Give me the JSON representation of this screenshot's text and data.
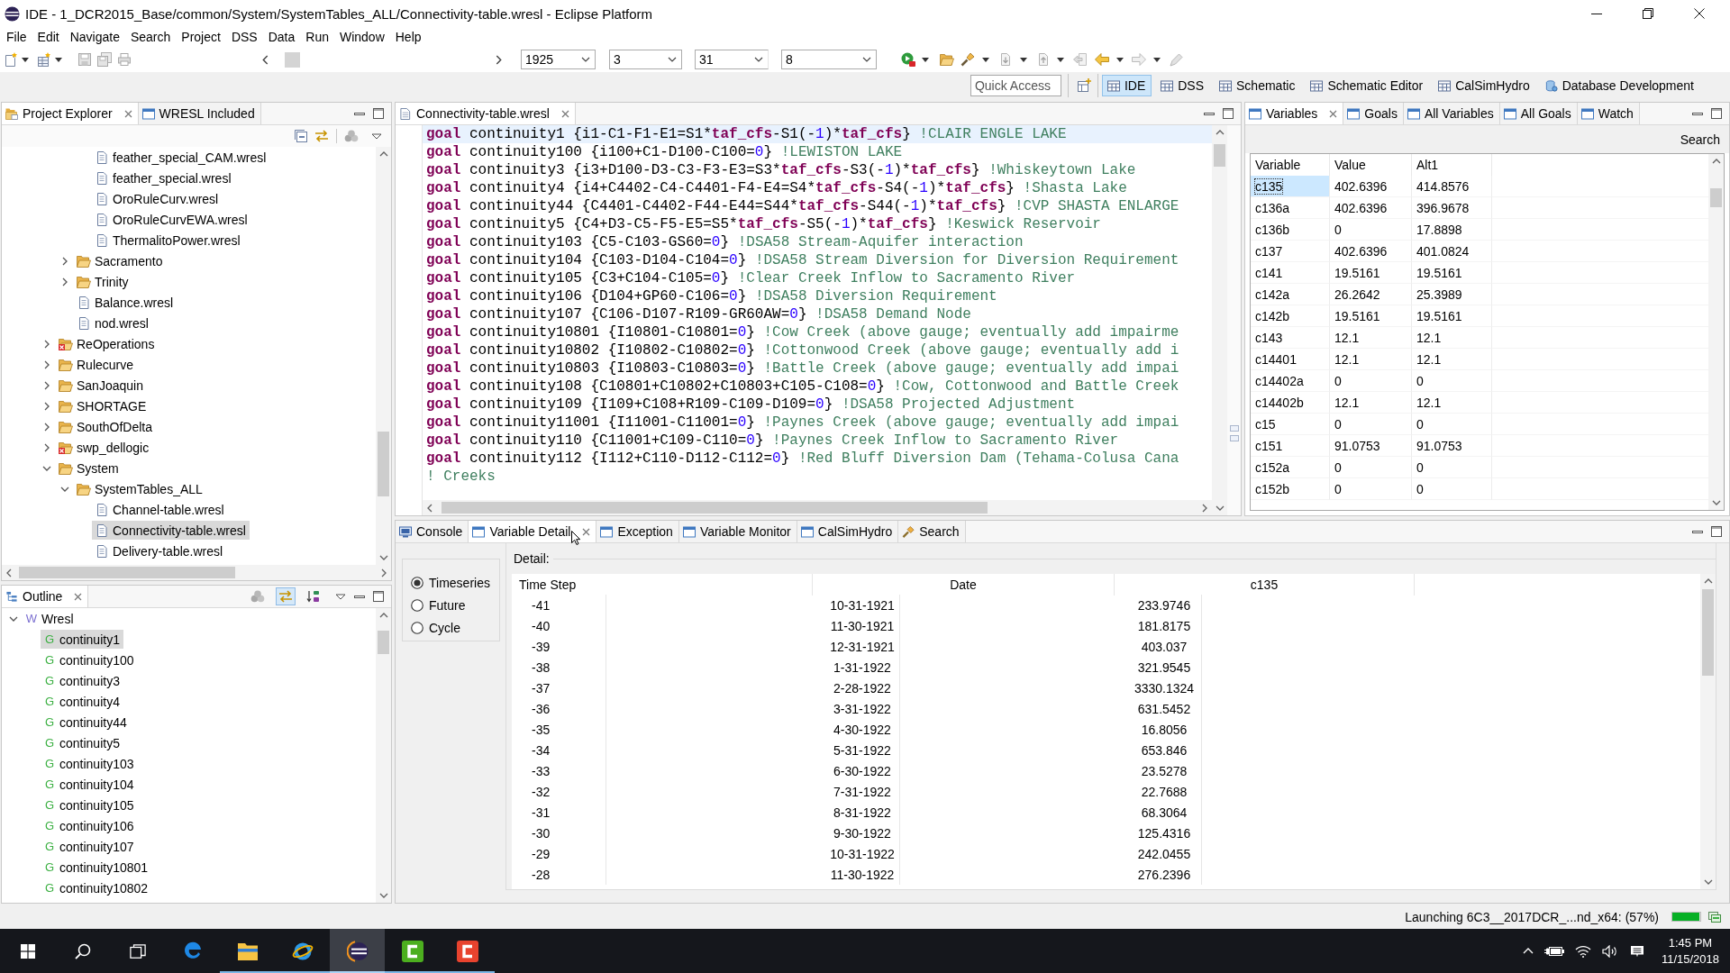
{
  "window": {
    "title": "IDE - 1_DCR2015_Base/common/System/SystemTables_ALL/Connectivity-table.wresl - Eclipse Platform"
  },
  "menu": [
    "File",
    "Edit",
    "Navigate",
    "Search",
    "Project",
    "DSS",
    "Data",
    "Run",
    "Window",
    "Help"
  ],
  "toolbar": {
    "dropdowns": [
      "1925",
      "3",
      "31",
      "8"
    ]
  },
  "perspective_bar": {
    "quick_access": {
      "placeholder": "Quick Access"
    },
    "perspectives": [
      {
        "label": "IDE",
        "kind": "grid",
        "selected": true
      },
      {
        "label": "DSS",
        "kind": "grid",
        "selected": false
      },
      {
        "label": "Schematic",
        "kind": "grid",
        "selected": false
      },
      {
        "label": "Schematic Editor",
        "kind": "grid",
        "selected": false
      },
      {
        "label": "CalSimHydro",
        "kind": "grid",
        "selected": false
      },
      {
        "label": "Database Development",
        "kind": "database",
        "selected": false
      }
    ]
  },
  "project_explorer": {
    "tabs": [
      {
        "label": "Project Explorer",
        "kind": "explorer",
        "selected": true
      },
      {
        "label": "WRESL Included",
        "kind": "view",
        "selected": false
      }
    ],
    "tree": [
      {
        "children": [
          {
            "children": [
              {
                "kind": "file",
                "label": "feather_special_CAM.wresl",
                "selected": false,
                "error": false
              },
              {
                "kind": "file",
                "label": "feather_special.wresl",
                "selected": false,
                "error": false
              },
              {
                "kind": "file",
                "label": "OroRuleCurv.wresl",
                "selected": false,
                "error": false
              },
              {
                "kind": "file",
                "label": "OroRuleCurvEWA.wresl",
                "selected": false,
                "error": false
              },
              {
                "kind": "file",
                "label": "ThermalitoPower.wresl",
                "selected": false,
                "error": false
              }
            ]
          },
          {
            "kind": "folder",
            "label": "Sacramento",
            "expanded": false,
            "selected": false,
            "error": false
          },
          {
            "kind": "folder",
            "label": "Trinity",
            "expanded": false,
            "selected": false,
            "error": false
          },
          {
            "kind": "file",
            "label": "Balance.wresl",
            "selected": false,
            "error": false
          },
          {
            "kind": "file",
            "label": "nod.wresl",
            "selected": false,
            "error": false
          }
        ]
      },
      {
        "kind": "folder",
        "label": "ReOperations",
        "expanded": false,
        "selected": false,
        "error": true
      },
      {
        "kind": "folder",
        "label": "Rulecurve",
        "expanded": false,
        "selected": false,
        "error": false
      },
      {
        "kind": "folder",
        "label": "SanJoaquin",
        "expanded": false,
        "selected": false,
        "error": false
      },
      {
        "kind": "folder",
        "label": "SHORTAGE",
        "expanded": false,
        "selected": false,
        "error": false
      },
      {
        "kind": "folder",
        "label": "SouthOfDelta",
        "expanded": false,
        "selected": false,
        "error": false
      },
      {
        "kind": "folder",
        "label": "swp_dellogic",
        "expanded": false,
        "selected": false,
        "error": true
      },
      {
        "kind": "folder",
        "label": "System",
        "expanded": true,
        "selected": false,
        "error": false,
        "children": [
          {
            "kind": "folder",
            "label": "SystemTables_ALL",
            "expanded": true,
            "selected": false,
            "error": false,
            "children": [
              {
                "kind": "file",
                "label": "Channel-table.wresl",
                "selected": false,
                "error": false
              },
              {
                "kind": "file",
                "label": "Connectivity-table.wresl",
                "selected": true,
                "error": false
              },
              {
                "kind": "file",
                "label": "Delivery-table.wresl",
                "selected": false,
                "error": false
              }
            ]
          }
        ]
      }
    ]
  },
  "editor": {
    "tabs": [
      {
        "label": "Connectivity-table.wresl",
        "kind": "document",
        "selected": true
      }
    ],
    "lines": [
      {
        "current": true,
        "segments": [
          {
            "kind": "keyword",
            "text": "goal"
          },
          {
            "kind": "plain",
            "text": " continuity1 {i1-C1-F1-E1=S1*"
          },
          {
            "kind": "keyword",
            "text": "taf_cfs"
          },
          {
            "kind": "plain",
            "text": "-S1(-"
          },
          {
            "kind": "number",
            "text": "1"
          },
          {
            "kind": "plain",
            "text": ")*"
          },
          {
            "kind": "keyword",
            "text": "taf_cfs"
          },
          {
            "kind": "plain",
            "text": "} "
          },
          {
            "kind": "comment",
            "text": "!CLAIR ENGLE LAKE"
          }
        ]
      },
      {
        "current": false,
        "segments": [
          {
            "kind": "keyword",
            "text": "goal"
          },
          {
            "kind": "plain",
            "text": " continuity100 {i100+C1-D100-C100="
          },
          {
            "kind": "number",
            "text": "0"
          },
          {
            "kind": "plain",
            "text": "} "
          },
          {
            "kind": "comment",
            "text": "!LEWISTON LAKE"
          }
        ]
      },
      {
        "current": false,
        "segments": [
          {
            "kind": "keyword",
            "text": "goal"
          },
          {
            "kind": "plain",
            "text": " continuity3 {i3+D100-D3-C3-F3-E3=S3*"
          },
          {
            "kind": "keyword",
            "text": "taf_cfs"
          },
          {
            "kind": "plain",
            "text": "-S3(-"
          },
          {
            "kind": "number",
            "text": "1"
          },
          {
            "kind": "plain",
            "text": ")*"
          },
          {
            "kind": "keyword",
            "text": "taf_cfs"
          },
          {
            "kind": "plain",
            "text": "} "
          },
          {
            "kind": "comment",
            "text": "!Whiskeytown Lake"
          }
        ]
      },
      {
        "current": false,
        "segments": [
          {
            "kind": "keyword",
            "text": "goal"
          },
          {
            "kind": "plain",
            "text": " continuity4 {i4+C4402-C4-C4401-F4-E4=S4*"
          },
          {
            "kind": "keyword",
            "text": "taf_cfs"
          },
          {
            "kind": "plain",
            "text": "-S4(-"
          },
          {
            "kind": "number",
            "text": "1"
          },
          {
            "kind": "plain",
            "text": ")*"
          },
          {
            "kind": "keyword",
            "text": "taf_cfs"
          },
          {
            "kind": "plain",
            "text": "} "
          },
          {
            "kind": "comment",
            "text": "!Shasta Lake"
          }
        ]
      },
      {
        "current": false,
        "segments": [
          {
            "kind": "keyword",
            "text": "goal"
          },
          {
            "kind": "plain",
            "text": " continuity44 {C4401-C4402-F44-E44=S44*"
          },
          {
            "kind": "keyword",
            "text": "taf_cfs"
          },
          {
            "kind": "plain",
            "text": "-S44(-"
          },
          {
            "kind": "number",
            "text": "1"
          },
          {
            "kind": "plain",
            "text": ")*"
          },
          {
            "kind": "keyword",
            "text": "taf_cfs"
          },
          {
            "kind": "plain",
            "text": "} "
          },
          {
            "kind": "comment",
            "text": "!CVP SHASTA ENLARGE"
          }
        ]
      },
      {
        "current": false,
        "segments": [
          {
            "kind": "keyword",
            "text": "goal"
          },
          {
            "kind": "plain",
            "text": " continuity5 {C4+D3-C5-F5-E5=S5*"
          },
          {
            "kind": "keyword",
            "text": "taf_cfs"
          },
          {
            "kind": "plain",
            "text": "-S5(-"
          },
          {
            "kind": "number",
            "text": "1"
          },
          {
            "kind": "plain",
            "text": ")*"
          },
          {
            "kind": "keyword",
            "text": "taf_cfs"
          },
          {
            "kind": "plain",
            "text": "} "
          },
          {
            "kind": "comment",
            "text": "!Keswick Reservoir"
          }
        ]
      },
      {
        "current": false,
        "segments": [
          {
            "kind": "keyword",
            "text": "goal"
          },
          {
            "kind": "plain",
            "text": " continuity103 {C5-C103-GS60="
          },
          {
            "kind": "number",
            "text": "0"
          },
          {
            "kind": "plain",
            "text": "} "
          },
          {
            "kind": "comment",
            "text": "!DSA58 Stream-Aquifer interaction"
          }
        ]
      },
      {
        "current": false,
        "segments": [
          {
            "kind": "keyword",
            "text": "goal"
          },
          {
            "kind": "plain",
            "text": " continuity104 {C103-D104-C104="
          },
          {
            "kind": "number",
            "text": "0"
          },
          {
            "kind": "plain",
            "text": "} "
          },
          {
            "kind": "comment",
            "text": "!DSA58 Stream Diversion for Diversion Requirement"
          }
        ]
      },
      {
        "current": false,
        "segments": [
          {
            "kind": "keyword",
            "text": "goal"
          },
          {
            "kind": "plain",
            "text": " continuity105 {C3+C104-C105="
          },
          {
            "kind": "number",
            "text": "0"
          },
          {
            "kind": "plain",
            "text": "} "
          },
          {
            "kind": "comment",
            "text": "!Clear Creek Inflow to Sacramento River"
          }
        ]
      },
      {
        "current": false,
        "segments": [
          {
            "kind": "keyword",
            "text": "goal"
          },
          {
            "kind": "plain",
            "text": " continuity106 {D104+GP60-C106="
          },
          {
            "kind": "number",
            "text": "0"
          },
          {
            "kind": "plain",
            "text": "} "
          },
          {
            "kind": "comment",
            "text": "!DSA58 Diversion Requirement"
          }
        ]
      },
      {
        "current": false,
        "segments": [
          {
            "kind": "keyword",
            "text": "goal"
          },
          {
            "kind": "plain",
            "text": " continuity107 {C106-D107-R109-GR60AW="
          },
          {
            "kind": "number",
            "text": "0"
          },
          {
            "kind": "plain",
            "text": "} "
          },
          {
            "kind": "comment",
            "text": "!DSA58 Demand Node"
          }
        ]
      },
      {
        "current": false,
        "segments": [
          {
            "kind": "keyword",
            "text": "goal"
          },
          {
            "kind": "plain",
            "text": " continuity10801 {I10801-C10801="
          },
          {
            "kind": "number",
            "text": "0"
          },
          {
            "kind": "plain",
            "text": "} "
          },
          {
            "kind": "comment",
            "text": "!Cow Creek (above gauge; eventually add impairme"
          }
        ]
      },
      {
        "current": false,
        "segments": [
          {
            "kind": "keyword",
            "text": "goal"
          },
          {
            "kind": "plain",
            "text": " continuity10802 {I10802-C10802="
          },
          {
            "kind": "number",
            "text": "0"
          },
          {
            "kind": "plain",
            "text": "} "
          },
          {
            "kind": "comment",
            "text": "!Cottonwood Creek (above gauge; eventually add i"
          }
        ]
      },
      {
        "current": false,
        "segments": [
          {
            "kind": "keyword",
            "text": "goal"
          },
          {
            "kind": "plain",
            "text": " continuity10803 {I10803-C10803="
          },
          {
            "kind": "number",
            "text": "0"
          },
          {
            "kind": "plain",
            "text": "} "
          },
          {
            "kind": "comment",
            "text": "!Battle Creek (above gauge; eventually add impai"
          }
        ]
      },
      {
        "current": false,
        "segments": [
          {
            "kind": "keyword",
            "text": "goal"
          },
          {
            "kind": "plain",
            "text": " continuity108 {C10801+C10802+C10803+C105-C108="
          },
          {
            "kind": "number",
            "text": "0"
          },
          {
            "kind": "plain",
            "text": "} "
          },
          {
            "kind": "comment",
            "text": "!Cow, Cottonwood and Battle Creek"
          }
        ]
      },
      {
        "current": false,
        "segments": [
          {
            "kind": "keyword",
            "text": "goal"
          },
          {
            "kind": "plain",
            "text": " continuity109 {I109+C108+R109-C109-D109="
          },
          {
            "kind": "number",
            "text": "0"
          },
          {
            "kind": "plain",
            "text": "} "
          },
          {
            "kind": "comment",
            "text": "!DSA58 Projected Adjustment"
          }
        ]
      },
      {
        "current": false,
        "segments": [
          {
            "kind": "keyword",
            "text": "goal"
          },
          {
            "kind": "plain",
            "text": " continuity11001 {I11001-C11001="
          },
          {
            "kind": "number",
            "text": "0"
          },
          {
            "kind": "plain",
            "text": "} "
          },
          {
            "kind": "comment",
            "text": "!Paynes Creek (above gauge; eventually add impai"
          }
        ]
      },
      {
        "current": false,
        "segments": [
          {
            "kind": "keyword",
            "text": "goal"
          },
          {
            "kind": "plain",
            "text": " continuity110 {C11001+C109-C110="
          },
          {
            "kind": "number",
            "text": "0"
          },
          {
            "kind": "plain",
            "text": "} "
          },
          {
            "kind": "comment",
            "text": "!Paynes Creek Inflow to Sacramento River"
          }
        ]
      },
      {
        "current": false,
        "segments": [
          {
            "kind": "keyword",
            "text": "goal"
          },
          {
            "kind": "plain",
            "text": " continuity112 {I112+C110-D112-C112="
          },
          {
            "kind": "number",
            "text": "0"
          },
          {
            "kind": "plain",
            "text": "} "
          },
          {
            "kind": "comment",
            "text": "!Red Bluff Diversion Dam (Tehama-Colusa Cana"
          }
        ]
      },
      {
        "current": false,
        "segments": [
          {
            "kind": "comment",
            "text": "! Creeks"
          }
        ]
      }
    ]
  },
  "variables": {
    "tabs": [
      {
        "label": "Variables",
        "kind": "view",
        "selected": true
      },
      {
        "label": "Goals",
        "kind": "view",
        "selected": false
      },
      {
        "label": "All Variables",
        "kind": "view",
        "selected": false
      },
      {
        "label": "All Goals",
        "kind": "view",
        "selected": false
      },
      {
        "label": "Watch",
        "kind": "view",
        "selected": false
      }
    ],
    "search_label": "Search",
    "columns": [
      "Variable",
      "Value",
      "Alt1"
    ],
    "rows": [
      {
        "cells": [
          "c135",
          "402.6396",
          "414.8576"
        ],
        "selected": true
      },
      {
        "cells": [
          "c136a",
          "402.6396",
          "396.9678"
        ],
        "selected": false
      },
      {
        "cells": [
          "c136b",
          "0",
          "17.8898"
        ],
        "selected": false
      },
      {
        "cells": [
          "c137",
          "402.6396",
          "401.0824"
        ],
        "selected": false
      },
      {
        "cells": [
          "c141",
          "19.5161",
          "19.5161"
        ],
        "selected": false
      },
      {
        "cells": [
          "c142a",
          "26.2642",
          "25.3989"
        ],
        "selected": false
      },
      {
        "cells": [
          "c142b",
          "19.5161",
          "19.5161"
        ],
        "selected": false
      },
      {
        "cells": [
          "c143",
          "12.1",
          "12.1"
        ],
        "selected": false
      },
      {
        "cells": [
          "c14401",
          "12.1",
          "12.1"
        ],
        "selected": false
      },
      {
        "cells": [
          "c14402a",
          "0",
          "0"
        ],
        "selected": false
      },
      {
        "cells": [
          "c14402b",
          "12.1",
          "12.1"
        ],
        "selected": false
      },
      {
        "cells": [
          "c15",
          "0",
          "0"
        ],
        "selected": false
      },
      {
        "cells": [
          "c151",
          "91.0753",
          "91.0753"
        ],
        "selected": false
      },
      {
        "cells": [
          "c152a",
          "0",
          "0"
        ],
        "selected": false
      },
      {
        "cells": [
          "c152b",
          "0",
          "0"
        ],
        "selected": false
      }
    ]
  },
  "outline": {
    "tabs": [
      {
        "label": "Outline",
        "kind": "outline",
        "selected": true
      }
    ],
    "toggles": [
      {
        "kind": "filter",
        "on": false
      },
      {
        "kind": "link",
        "on": true
      },
      {
        "kind": "sort",
        "on": false
      }
    ],
    "tree": [
      {
        "kind": "root",
        "badge": "W",
        "label": "Wresl",
        "expanded": true,
        "selected": false,
        "children": [
          {
            "kind": "goal",
            "badge": "G",
            "label": "continuity1",
            "selected": true
          },
          {
            "kind": "goal",
            "badge": "G",
            "label": "continuity100",
            "selected": false
          },
          {
            "kind": "goal",
            "badge": "G",
            "label": "continuity3",
            "selected": false
          },
          {
            "kind": "goal",
            "badge": "G",
            "label": "continuity4",
            "selected": false
          },
          {
            "kind": "goal",
            "badge": "G",
            "label": "continuity44",
            "selected": false
          },
          {
            "kind": "goal",
            "badge": "G",
            "label": "continuity5",
            "selected": false
          },
          {
            "kind": "goal",
            "badge": "G",
            "label": "continuity103",
            "selected": false
          },
          {
            "kind": "goal",
            "badge": "G",
            "label": "continuity104",
            "selected": false
          },
          {
            "kind": "goal",
            "badge": "G",
            "label": "continuity105",
            "selected": false
          },
          {
            "kind": "goal",
            "badge": "G",
            "label": "continuity106",
            "selected": false
          },
          {
            "kind": "goal",
            "badge": "G",
            "label": "continuity107",
            "selected": false
          },
          {
            "kind": "goal",
            "badge": "G",
            "label": "continuity10801",
            "selected": false
          },
          {
            "kind": "goal",
            "badge": "G",
            "label": "continuity10802",
            "selected": false
          }
        ]
      }
    ]
  },
  "bottom_panel": {
    "tabs": [
      {
        "label": "Console",
        "kind": "console",
        "selected": false
      },
      {
        "label": "Variable Detail",
        "kind": "view",
        "selected": true
      },
      {
        "label": "Exception",
        "kind": "view",
        "selected": false
      },
      {
        "label": "Variable Monitor",
        "kind": "view",
        "selected": false
      },
      {
        "label": "CalSimHydro",
        "kind": "view",
        "selected": false
      },
      {
        "label": "Search",
        "kind": "search",
        "selected": false
      }
    ],
    "modes": [
      {
        "label": "Timeseries",
        "selected": true
      },
      {
        "label": "Future",
        "selected": false
      },
      {
        "label": "Cycle",
        "selected": false
      }
    ],
    "detail_label": "Detail:",
    "columns": [
      "Time Step",
      "Date",
      "c135"
    ],
    "rows": [
      [
        "-41",
        "10-31-1921",
        "233.9746"
      ],
      [
        "-40",
        "11-30-1921",
        "181.8175"
      ],
      [
        "-39",
        "12-31-1921",
        "403.037"
      ],
      [
        "-38",
        "1-31-1922",
        "321.9545"
      ],
      [
        "-37",
        "2-28-1922",
        "3330.1324"
      ],
      [
        "-36",
        "3-31-1922",
        "631.5452"
      ],
      [
        "-35",
        "4-30-1922",
        "16.8056"
      ],
      [
        "-34",
        "5-31-1922",
        "653.846"
      ],
      [
        "-33",
        "6-30-1922",
        "23.5278"
      ],
      [
        "-32",
        "7-31-1922",
        "22.7688"
      ],
      [
        "-31",
        "8-31-1922",
        "68.3064"
      ],
      [
        "-30",
        "9-30-1922",
        "125.4316"
      ],
      [
        "-29",
        "10-31-1922",
        "242.0455"
      ],
      [
        "-28",
        "11-30-1922",
        "276.2396"
      ]
    ]
  },
  "status_bar": {
    "message": "Launching 6C3__2017DCR_...nd_x64: (57%)",
    "progress": {
      "level": 0.97
    }
  },
  "taskbar": {
    "apps": [
      {
        "kind": "edge",
        "active": false,
        "running": false
      },
      {
        "kind": "explorer",
        "active": false,
        "running": true
      },
      {
        "kind": "ie",
        "active": false,
        "running": true
      },
      {
        "kind": "eclipse",
        "active": true,
        "running": true
      },
      {
        "kind": "recorder",
        "active": false,
        "running": true
      },
      {
        "kind": "studio",
        "active": false,
        "running": true
      }
    ],
    "clock": {
      "time": "1:45 PM",
      "date": "11/15/2018"
    }
  }
}
